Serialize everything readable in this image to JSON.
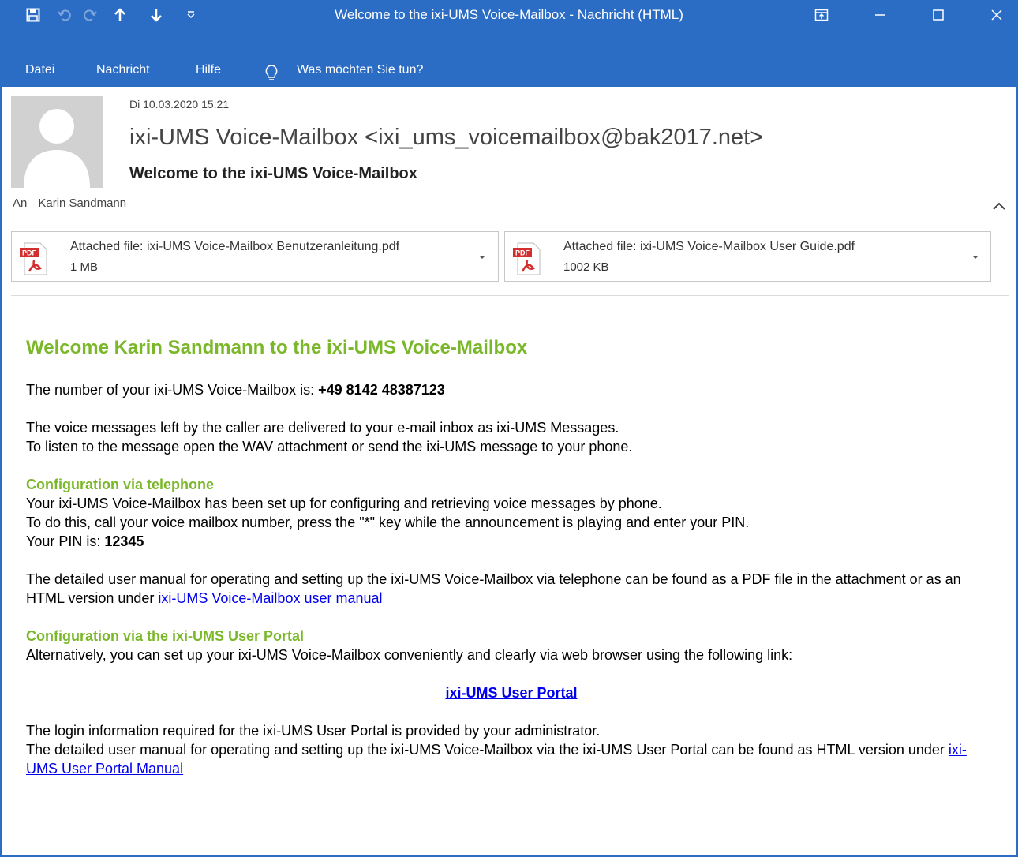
{
  "window": {
    "title": "Welcome to the ixi-UMS Voice-Mailbox  -  Nachricht (HTML)",
    "accent_color": "#2b6cc4",
    "qat_icons": [
      "save-icon",
      "undo-icon",
      "redo-icon",
      "up-arrow-icon",
      "down-arrow-icon",
      "customize-icon"
    ],
    "controls": [
      "ribbon-display-icon",
      "minimize-icon",
      "maximize-icon",
      "close-icon"
    ]
  },
  "menu": {
    "file": "Datei",
    "message": "Nachricht",
    "help": "Hilfe",
    "tell_me": "Was möchten Sie tun?"
  },
  "header": {
    "date": "Di 10.03.2020 15:21",
    "sender": "ixi-UMS Voice-Mailbox <ixi_ums_voicemailbox@bak2017.net>",
    "subject": "Welcome to the ixi-UMS Voice-Mailbox",
    "to_label": "An",
    "to_value": "Karin Sandmann"
  },
  "attachments": [
    {
      "name": "Attached file: ixi-UMS Voice-Mailbox Benutzeranleitung.pdf",
      "size": "1 MB",
      "icon": "pdf-icon"
    },
    {
      "name": "Attached file: ixi-UMS Voice-Mailbox User Guide.pdf",
      "size": "1002 KB",
      "icon": "pdf-icon"
    }
  ],
  "body": {
    "heading": "Welcome Karin Sandmann to the ixi-UMS Voice-Mailbox",
    "number_text": "The number of your ixi-UMS Voice-Mailbox is: ",
    "number": "+49 8142 48387123",
    "voice_line1": "The voice messages left by the caller are delivered to your e-mail inbox as ixi-UMS Messages.",
    "voice_line2": "To listen to the message open the WAV attachment or send the ixi-UMS message to your phone.",
    "tel_heading": "Configuration via telephone",
    "tel_line1": "Your ixi-UMS Voice-Mailbox has been set up for configuring and retrieving voice messages by phone.",
    "tel_line2": "To do this, call your voice mailbox number, press the \"*\" key while the announcement is playing and enter your PIN.",
    "pin_label": "Your PIN is: ",
    "pin": "12345",
    "manual_text": "The detailed user manual for operating and setting up the ixi-UMS Voice-Mailbox via telephone can be found as a PDF file in the attachment or as an HTML version under ",
    "manual_link": "ixi-UMS Voice-Mailbox user manual",
    "portal_heading": "Configuration via the ixi-UMS User Portal",
    "portal_line": "Alternatively, you can set up your ixi-UMS Voice-Mailbox conveniently and clearly via web browser using the following link:",
    "portal_link": "ixi-UMS User Portal",
    "login_line": "The login information required for the ixi-UMS User Portal is provided by your administrator.",
    "portal_manual_text": "The detailed user manual for operating and setting up the ixi-UMS Voice-Mailbox via the ixi-UMS User Portal can be found as HTML version under ",
    "portal_manual_link": "ixi-UMS User Portal Manual",
    "heading_color": "#7ab829",
    "link_color": "#0000ee"
  }
}
